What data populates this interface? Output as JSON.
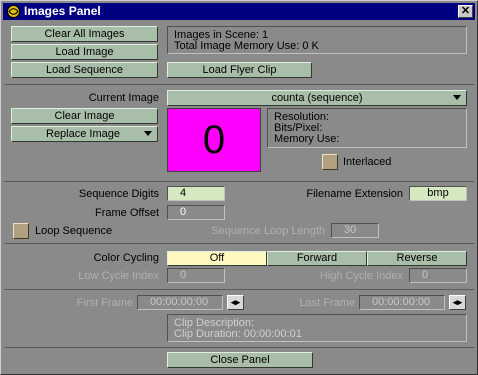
{
  "window": {
    "title": "Images Panel",
    "close_label": "✕"
  },
  "buttons": {
    "clear_all": "Clear All Images",
    "load_image": "Load Image",
    "load_sequence": "Load Sequence",
    "load_flyer": "Load Flyer Clip",
    "clear_image": "Clear Image",
    "replace_image": "Replace Image",
    "close_panel": "Close Panel"
  },
  "scene_info": {
    "images_in_scene": "Images in Scene: 1",
    "total_memory": "Total Image Memory Use: 0 K"
  },
  "current_image": {
    "label": "Current Image",
    "value": "counta (sequence)",
    "preview_glyph": "0",
    "preview_color": "#ff00ff",
    "resolution_label": "Resolution:",
    "bits_label": "Bits/Pixel:",
    "memory_label": "Memory Use:",
    "interlaced_label": "Interlaced"
  },
  "sequence": {
    "digits_label": "Sequence Digits",
    "digits_value": "4",
    "extension_label": "Filename Extension",
    "extension_value": "bmp",
    "offset_label": "Frame Offset",
    "offset_value": "0",
    "loop_label": "Loop Sequence",
    "loop_length_label": "Sequence Loop Length",
    "loop_length_value": "30"
  },
  "color_cycling": {
    "label": "Color Cycling",
    "options": [
      "Off",
      "Forward",
      "Reverse"
    ],
    "selected": "Off",
    "low_label": "Low Cycle Index",
    "low_value": "0",
    "high_label": "High Cycle Index",
    "high_value": "0"
  },
  "flyer": {
    "first_label": "First Frame",
    "first_value": "00:00:00:00",
    "last_label": "Last Frame",
    "last_value": "00:00:00:00",
    "spin_glyph": "◂▸",
    "description": "Clip Description:",
    "duration": "Clip Duration: 00:00:00:01"
  },
  "colors": {
    "title_bar": "#000080",
    "panel": "#8a8a8a",
    "button": "#a9bea9",
    "selected_segment": "#fff8c0"
  }
}
